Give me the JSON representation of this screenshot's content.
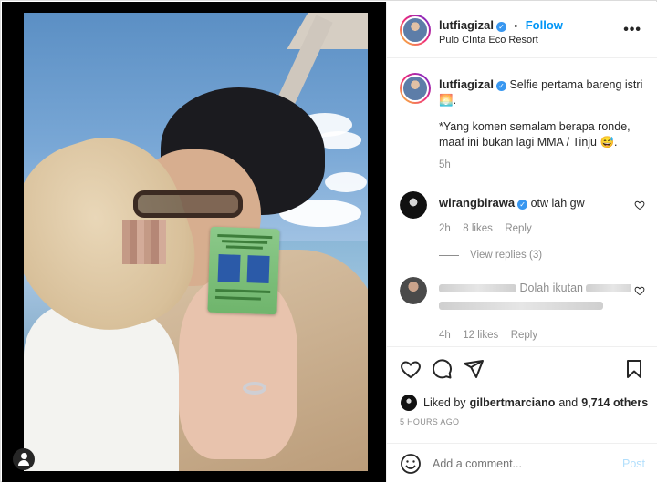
{
  "post": {
    "author": "lutfiagizal",
    "follow_label": "Follow",
    "separator": "•",
    "location": "Pulo CInta Eco Resort",
    "more_label": "•••"
  },
  "caption": {
    "username": "lutfiagizal",
    "line1": "Selfie pertama bareng istri",
    "emoji": "🌅",
    "line1_end": ".",
    "line2": "*Yang komen semalam berapa ronde,",
    "line3": "maaf ini bukan lagi MMA / Tinju 😅.",
    "time": "5h"
  },
  "comments": [
    {
      "username": "wirangbirawa",
      "text": "otw lah gw",
      "time": "2h",
      "likes": "8 likes",
      "reply": "Reply",
      "view_replies": "View replies (3)"
    },
    {
      "username": "",
      "text_fragment": "Dolah ikutan",
      "time": "4h",
      "likes": "12 likes",
      "reply": "Reply"
    }
  ],
  "liked_by": {
    "prefix": "Liked by",
    "user": "gilbertmarciano",
    "and": "and",
    "others": "9,714 others"
  },
  "timestamp": "5 HOURS AGO",
  "add_comment": {
    "placeholder": "Add a comment...",
    "post_label": "Post"
  }
}
